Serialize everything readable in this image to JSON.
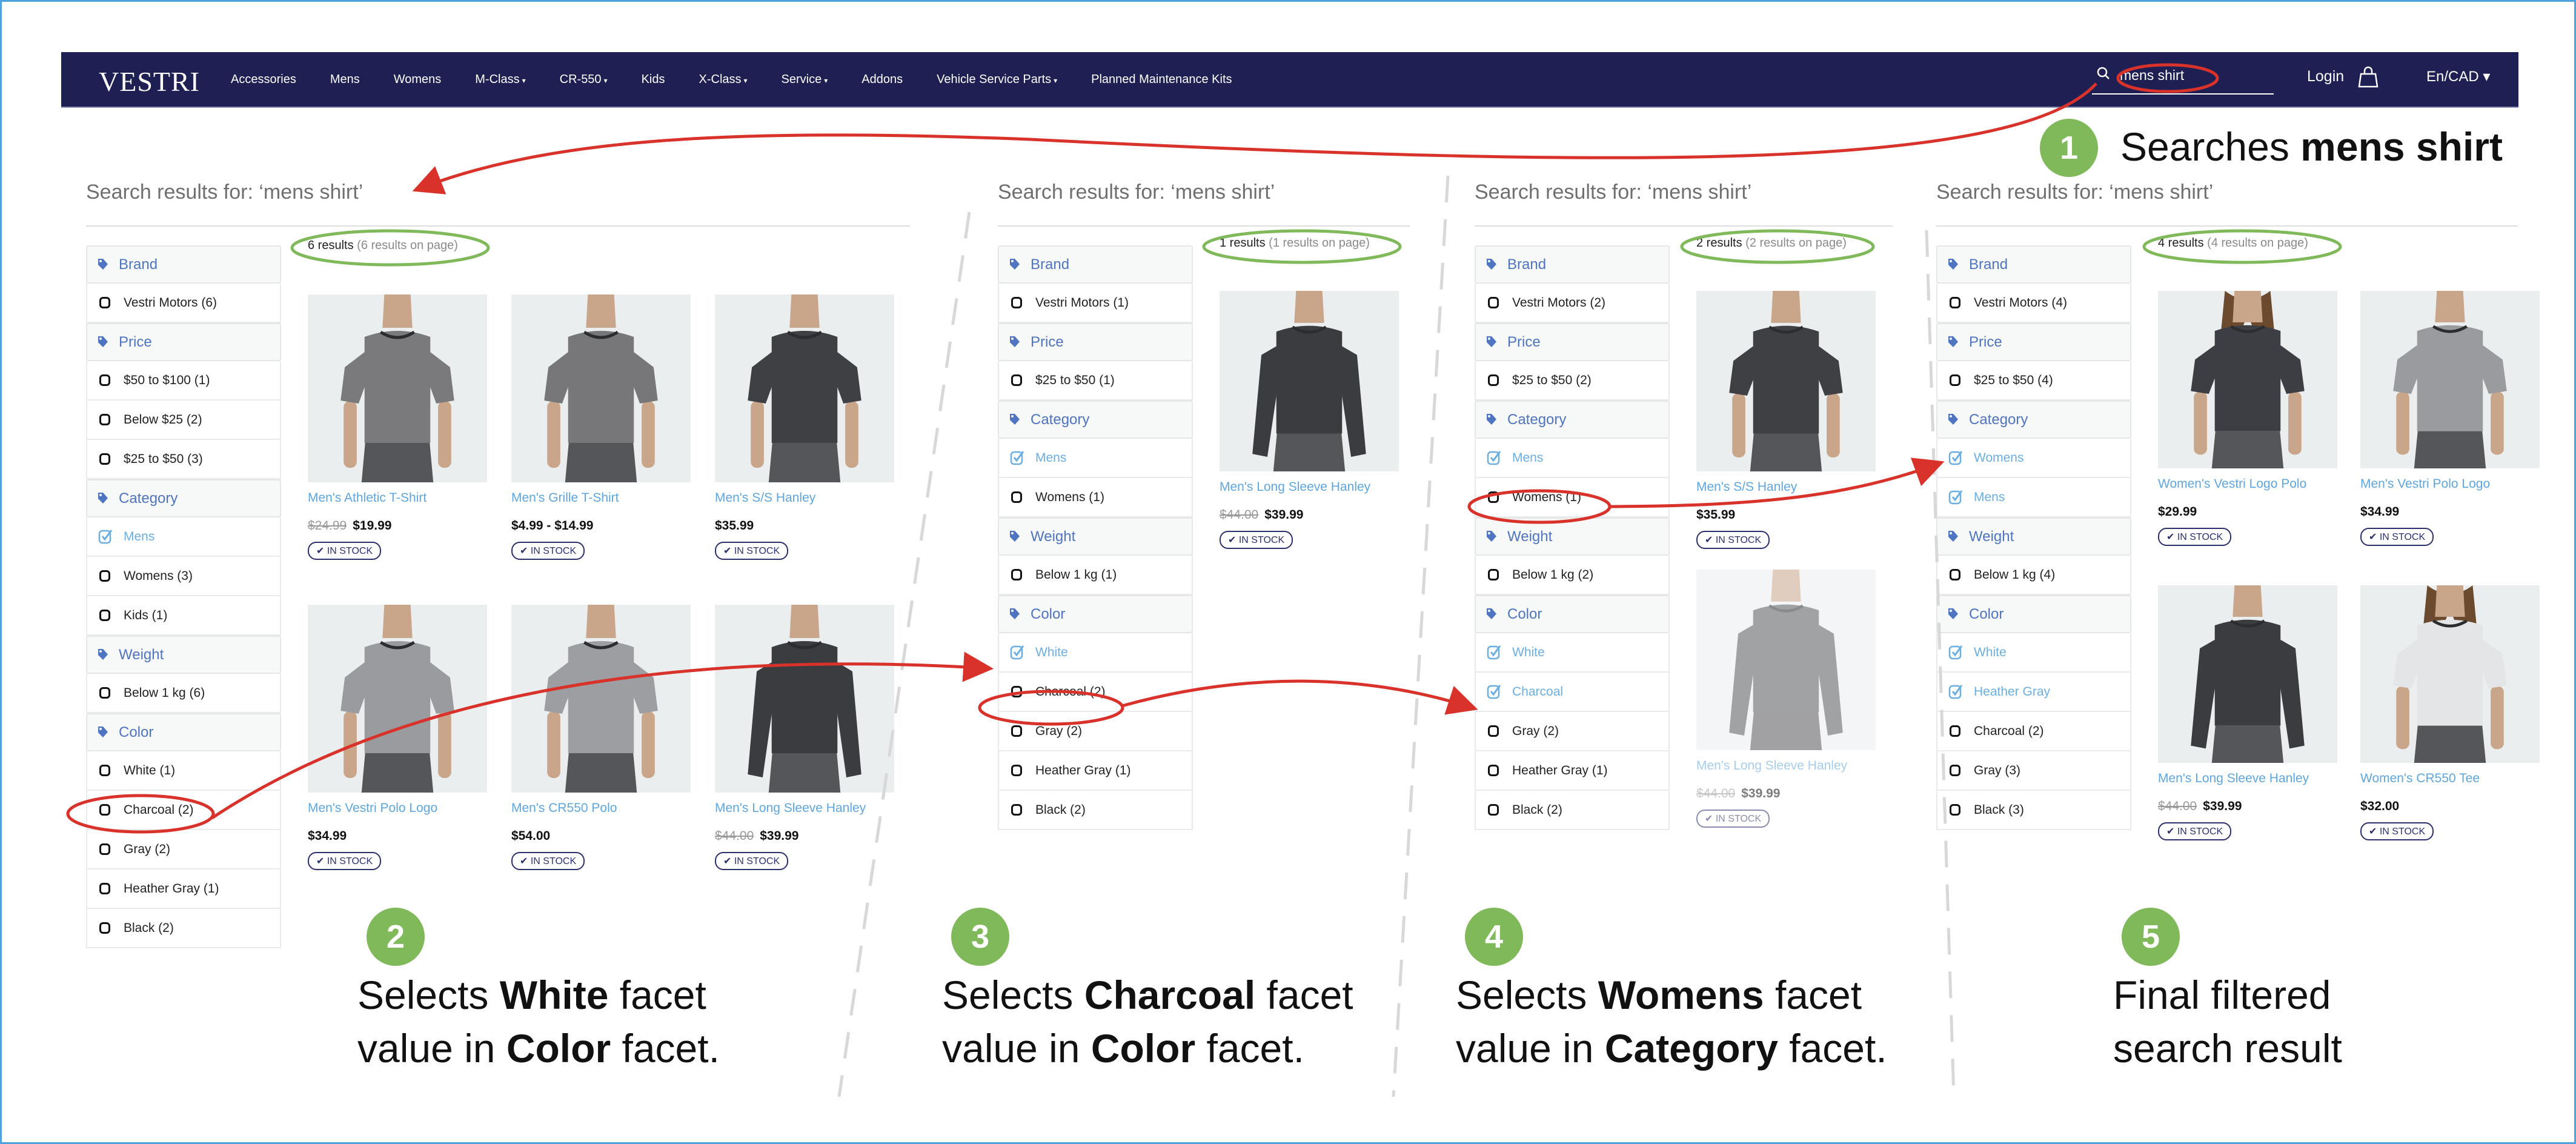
{
  "nav": {
    "logo": "VESTRI",
    "links": [
      {
        "label": "Accessories",
        "caret": ""
      },
      {
        "label": "Mens",
        "caret": ""
      },
      {
        "label": "Womens",
        "caret": ""
      },
      {
        "label": "M-Class",
        "caret": "▾"
      },
      {
        "label": "CR-550",
        "caret": "▾"
      },
      {
        "label": "Kids",
        "caret": ""
      },
      {
        "label": "X-Class",
        "caret": "▾"
      },
      {
        "label": "Service",
        "caret": "▾"
      },
      {
        "label": "Addons",
        "caret": ""
      },
      {
        "label": "Vehicle Service Parts",
        "caret": "▾"
      },
      {
        "label": "Planned Maintenance Kits",
        "caret": ""
      }
    ],
    "search_value": "mens shirt",
    "login": "Login",
    "lang": "En/CAD ▾"
  },
  "panels": [
    {
      "title": "Search results for: ‘mens shirt’",
      "count": "6 results",
      "count_sub": "(6 results on page)",
      "facets": [
        {
          "title": "Brand",
          "items": [
            {
              "label": "Vestri Motors (6)",
              "checked": false
            }
          ]
        },
        {
          "title": "Price",
          "items": [
            {
              "label": "$50 to $100 (1)",
              "checked": false
            },
            {
              "label": "Below $25 (2)",
              "checked": false
            },
            {
              "label": "$25 to $50 (3)",
              "checked": false
            }
          ]
        },
        {
          "title": "Category",
          "items": [
            {
              "label": "Mens",
              "checked": true
            },
            {
              "label": "Womens (3)",
              "checked": false
            },
            {
              "label": "Kids (1)",
              "checked": false
            }
          ]
        },
        {
          "title": "Weight",
          "items": [
            {
              "label": "Below 1 kg (6)",
              "checked": false
            }
          ]
        },
        {
          "title": "Color",
          "items": [
            {
              "label": "White (1)",
              "checked": false
            },
            {
              "label": "Charcoal (2)",
              "checked": false
            },
            {
              "label": "Gray (2)",
              "checked": false
            },
            {
              "label": "Heather Gray (1)",
              "checked": false
            },
            {
              "label": "Black (2)",
              "checked": false
            }
          ]
        }
      ],
      "products": [
        {
          "name": "Men's Athletic T-Shirt",
          "old_price": "$24.99",
          "price": "$19.99",
          "stock": "IN STOCK",
          "shirt": "#7a7a7c"
        },
        {
          "name": "Men's Grille T-Shirt",
          "old_price": "",
          "price": "$4.99 - $14.99",
          "stock": "IN STOCK",
          "shirt": "#77777a"
        },
        {
          "name": "Men's S/S Hanley",
          "old_price": "",
          "price": "$35.99",
          "stock": "IN STOCK",
          "shirt": "#3f4043"
        },
        {
          "name": "Men's Vestri Polo Logo",
          "old_price": "",
          "price": "$34.99",
          "stock": "IN STOCK",
          "shirt": "#9a9b9e"
        },
        {
          "name": "Men's CR550 Polo",
          "old_price": "",
          "price": "$54.00",
          "stock": "IN STOCK",
          "shirt": "#9d9ea1"
        },
        {
          "name": "Men's Long Sleeve Hanley",
          "old_price": "$44.00",
          "price": "$39.99",
          "stock": "IN STOCK",
          "shirt": "#3a3c40"
        }
      ]
    },
    {
      "title": "Search results for: ‘mens shirt’",
      "count": "1 results",
      "count_sub": "(1 results on page)",
      "facets": [
        {
          "title": "Brand",
          "items": [
            {
              "label": "Vestri Motors (1)",
              "checked": false
            }
          ]
        },
        {
          "title": "Price",
          "items": [
            {
              "label": "$25 to $50 (1)",
              "checked": false
            }
          ]
        },
        {
          "title": "Category",
          "items": [
            {
              "label": "Mens",
              "checked": true
            },
            {
              "label": "Womens (1)",
              "checked": false
            }
          ]
        },
        {
          "title": "Weight",
          "items": [
            {
              "label": "Below 1 kg (1)",
              "checked": false
            }
          ]
        },
        {
          "title": "Color",
          "items": [
            {
              "label": "White",
              "checked": true
            },
            {
              "label": "Charcoal (2)",
              "checked": false
            },
            {
              "label": "Gray (2)",
              "checked": false
            },
            {
              "label": "Heather Gray (1)",
              "checked": false
            },
            {
              "label": "Black (2)",
              "checked": false
            }
          ]
        }
      ],
      "products": [
        {
          "name": "Men's Long Sleeve Hanley",
          "old_price": "$44.00",
          "price": "$39.99",
          "stock": "IN STOCK",
          "shirt": "#3a3c40"
        }
      ]
    },
    {
      "title": "Search results for: ‘mens shirt’",
      "count": "2 results",
      "count_sub": "(2 results on page)",
      "facets": [
        {
          "title": "Brand",
          "items": [
            {
              "label": "Vestri Motors (2)",
              "checked": false
            }
          ]
        },
        {
          "title": "Price",
          "items": [
            {
              "label": "$25 to $50 (2)",
              "checked": false
            }
          ]
        },
        {
          "title": "Category",
          "items": [
            {
              "label": "Mens",
              "checked": true
            },
            {
              "label": "Womens (1)",
              "checked": false
            }
          ]
        },
        {
          "title": "Weight",
          "items": [
            {
              "label": "Below 1 kg (2)",
              "checked": false
            }
          ]
        },
        {
          "title": "Color",
          "items": [
            {
              "label": "White",
              "checked": true
            },
            {
              "label": "Charcoal",
              "checked": true
            },
            {
              "label": "Gray (2)",
              "checked": false
            },
            {
              "label": "Heather Gray (1)",
              "checked": false
            },
            {
              "label": "Black (2)",
              "checked": false
            }
          ]
        }
      ],
      "products": [
        {
          "name": "Men's S/S Hanley",
          "old_price": "",
          "price": "$35.99",
          "stock": "IN STOCK",
          "shirt": "#3f4043"
        },
        {
          "name": "Men's Long Sleeve Hanley",
          "old_price": "$44.00",
          "price": "$39.99",
          "stock": "IN STOCK",
          "shirt": "#55575b"
        }
      ]
    },
    {
      "title": "Search results for: ‘mens shirt’",
      "count": "4 results",
      "count_sub": "(4 results on page)",
      "facets": [
        {
          "title": "Brand",
          "items": [
            {
              "label": "Vestri Motors (4)",
              "checked": false
            }
          ]
        },
        {
          "title": "Price",
          "items": [
            {
              "label": "$25 to $50 (4)",
              "checked": false
            }
          ]
        },
        {
          "title": "Category",
          "items": [
            {
              "label": "Womens",
              "checked": true
            },
            {
              "label": "Mens",
              "checked": true
            }
          ]
        },
        {
          "title": "Weight",
          "items": [
            {
              "label": "Below 1 kg (4)",
              "checked": false
            }
          ]
        },
        {
          "title": "Color",
          "items": [
            {
              "label": "White",
              "checked": true
            },
            {
              "label": "Heather Gray",
              "checked": true
            },
            {
              "label": "Charcoal (2)",
              "checked": false
            },
            {
              "label": "Gray (3)",
              "checked": false
            },
            {
              "label": "Black (3)",
              "checked": false
            }
          ]
        }
      ],
      "products": [
        {
          "name": "Women's Vestri Logo Polo",
          "old_price": "",
          "price": "$29.99",
          "stock": "IN STOCK",
          "shirt": "#3c3e44"
        },
        {
          "name": "Men's Vestri Polo Logo",
          "old_price": "",
          "price": "$34.99",
          "stock": "IN STOCK",
          "shirt": "#9a9b9e"
        },
        {
          "name": "Men's Long Sleeve Hanley",
          "old_price": "$44.00",
          "price": "$39.99",
          "stock": "IN STOCK",
          "shirt": "#3a3c40"
        },
        {
          "name": "Women's CR550 Tee",
          "old_price": "",
          "price": "$32.00",
          "stock": "IN STOCK",
          "shirt": "#e4e5e7"
        }
      ]
    }
  ],
  "steps": [
    {
      "num": "1",
      "pre": "Searches ",
      "bold": "mens shirt",
      "post": "",
      "line2_pre": "",
      "line2_bold": "",
      "line2_post": ""
    },
    {
      "num": "2",
      "pre": "Selects ",
      "bold": "White",
      "post": " facet",
      "line2_pre": "value in ",
      "line2_bold": "Color",
      "line2_post": " facet."
    },
    {
      "num": "3",
      "pre": "Selects ",
      "bold": "Charcoal",
      "post": " facet",
      "line2_pre": "value in ",
      "line2_bold": "Color",
      "line2_post": " facet."
    },
    {
      "num": "4",
      "pre": "Selects ",
      "bold": "Womens",
      "post": " facet",
      "line2_pre": "value in ",
      "line2_bold": "Category",
      "line2_post": " facet."
    },
    {
      "num": "5",
      "pre": "Final filtered",
      "bold": "",
      "post": "",
      "line2_pre": "search result",
      "line2_bold": "",
      "line2_post": ""
    }
  ],
  "colors": {
    "nav_bg": "#1e1f53",
    "facet_title": "#4f74c1",
    "product_link": "#5ea6e0",
    "step_badge": "#7fb95a",
    "annotation_red": "#d9322b",
    "annotation_green": "#7fb95a"
  }
}
